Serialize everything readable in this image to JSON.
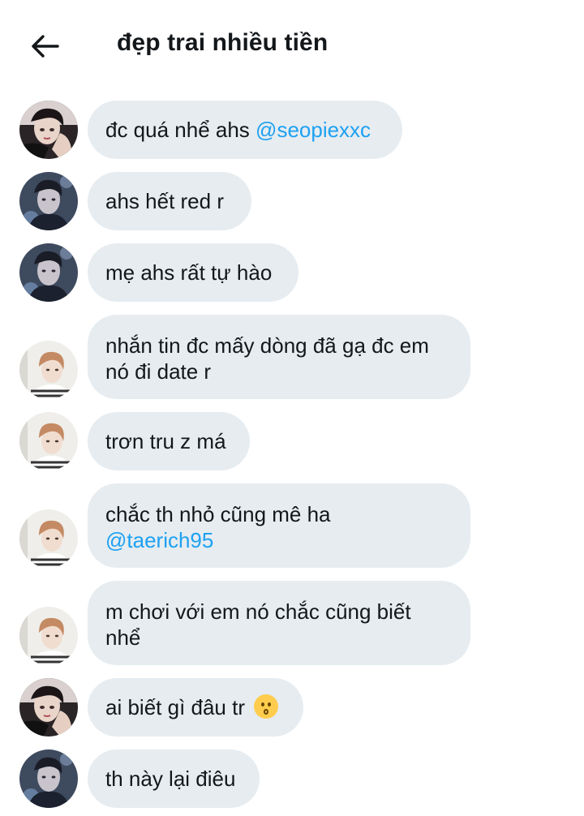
{
  "header": {
    "title": "đẹp trai nhiều tiền"
  },
  "messages": [
    {
      "avatar": "a",
      "lines": [
        [
          {
            "t": "đc quá nhể ahs "
          },
          {
            "t": "@seopiexxc",
            "mention": true
          }
        ]
      ]
    },
    {
      "avatar": "b",
      "lines": [
        [
          {
            "t": "ahs hết red r"
          }
        ]
      ]
    },
    {
      "avatar": "b",
      "lines": [
        [
          {
            "t": "mẹ ahs rất tự hào"
          }
        ]
      ]
    },
    {
      "avatar": "c",
      "lines": [
        [
          {
            "t": "nhắn tin đc mấy dòng đã gạ đc em"
          }
        ],
        [
          {
            "t": "nó đi date r"
          }
        ]
      ]
    },
    {
      "avatar": "c",
      "lines": [
        [
          {
            "t": "trơn tru z má"
          }
        ]
      ]
    },
    {
      "avatar": "c",
      "lines": [
        [
          {
            "t": "chắc th nhỏ cũng mê ha"
          }
        ],
        [
          {
            "t": "@taerich95",
            "mention": true
          }
        ]
      ]
    },
    {
      "avatar": "c",
      "lines": [
        [
          {
            "t": "m chơi với em nó chắc cũng biết"
          }
        ],
        [
          {
            "t": "nhể"
          }
        ]
      ]
    },
    {
      "avatar": "a",
      "lines": [
        [
          {
            "t": "ai biết gì đâu tr "
          },
          {
            "emoji": "kissing-face"
          }
        ]
      ]
    },
    {
      "avatar": "b",
      "lines": [
        [
          {
            "t": "th này lại điêu"
          }
        ]
      ]
    }
  ],
  "colors": {
    "bubble": "#e6ecf0",
    "mention": "#1da1f2",
    "text": "#14171a"
  }
}
